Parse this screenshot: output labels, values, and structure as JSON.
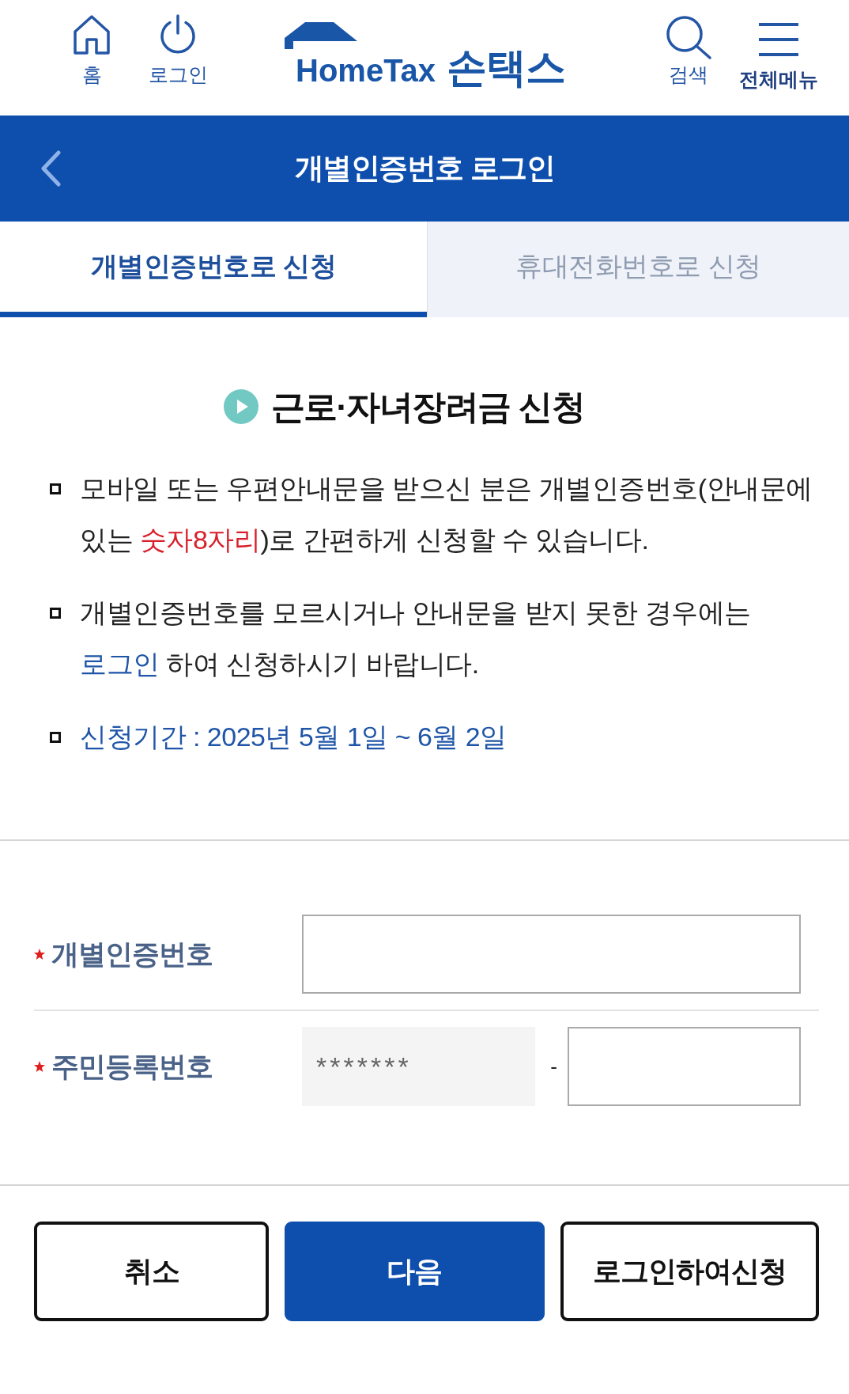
{
  "header": {
    "nav_left": [
      {
        "kind": "home",
        "label": "홈"
      },
      {
        "kind": "power",
        "label": "로그인"
      }
    ],
    "logo": {
      "latin": "HomeTax",
      "korean": "손택스"
    },
    "nav_right": [
      {
        "kind": "search",
        "label": "검색"
      },
      {
        "kind": "menu",
        "label": "전체메뉴"
      }
    ]
  },
  "title_bar": {
    "title": "개별인증번호 로그인"
  },
  "tabs": [
    {
      "label": "개별인증번호로 신청",
      "selected": true
    },
    {
      "label": "휴대전화번호로 신청",
      "selected": false
    }
  ],
  "notice": {
    "title": "근로·자녀장려금 신청",
    "bullets": [
      {
        "segments": [
          {
            "kind": "text",
            "text": "모바일 또는 우편안내문을 받으신 분은 개별인증번호(안내문에 있는 "
          },
          {
            "kind": "emphasis",
            "text": "숫자8자리"
          },
          {
            "kind": "text",
            "text": ")로 간편하게 신청할 수 있습니다."
          }
        ]
      },
      {
        "segments": [
          {
            "kind": "text",
            "text": "개별인증번호를 모르시거나 안내문을 받지 못한 경우에는 "
          },
          {
            "kind": "link",
            "text": "로그인"
          },
          {
            "kind": "text",
            "text": " 하여 신청하시기 바랍니다."
          }
        ]
      },
      {
        "segments": [
          {
            "kind": "highlight",
            "text": "신청기간 : 2025년 5월 1일 ~ 6월 2일"
          }
        ]
      }
    ]
  },
  "form": {
    "fields": [
      {
        "label": "개별인증번호",
        "required": true,
        "inputs": [
          {
            "disabled": false
          }
        ]
      },
      {
        "label": "주민등록번호",
        "required": true,
        "separator": "-",
        "inputs": [
          {
            "disabled": true,
            "value": "*******"
          },
          {
            "disabled": false
          }
        ]
      }
    ]
  },
  "buttons": [
    {
      "label": "취소",
      "kind": "outline"
    },
    {
      "label": "다음",
      "kind": "filled"
    },
    {
      "label": "로그인하여신청",
      "kind": "outline"
    }
  ]
}
